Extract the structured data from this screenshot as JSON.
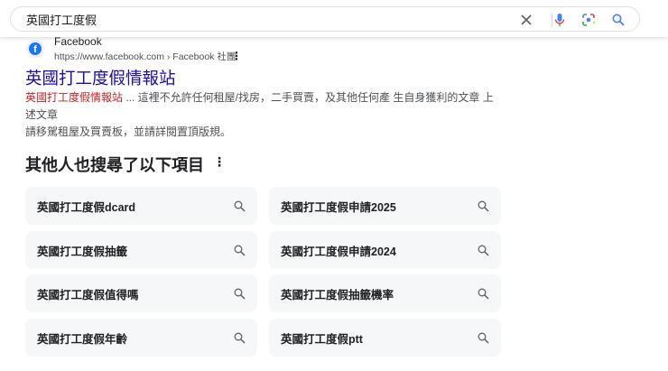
{
  "search": {
    "query": "英國打工度假"
  },
  "result": {
    "site_name": "Facebook",
    "url": "https://www.facebook.com › Facebook 社團",
    "title": "英國打工度假情報站",
    "snippet_highlight": "英國打工度假情報站",
    "snippet_line1": " ... 這裡不允許任何租屋/找房，二手買賣，及其他任何產 生自身獲利的文章 上述文章",
    "snippet_line2": "請移駕租屋及買賣板，並請詳閱置頂版規。"
  },
  "related": {
    "heading": "其他人也搜尋了以下項目",
    "items": [
      "英國打工度假dcard",
      "英國打工度假申請2025",
      "英國打工度假抽籤",
      "英國打工度假申請2024",
      "英國打工度假值得嗎",
      "英國打工度假抽籤機率",
      "英國打工度假年齡",
      "英國打工度假ptt"
    ]
  }
}
